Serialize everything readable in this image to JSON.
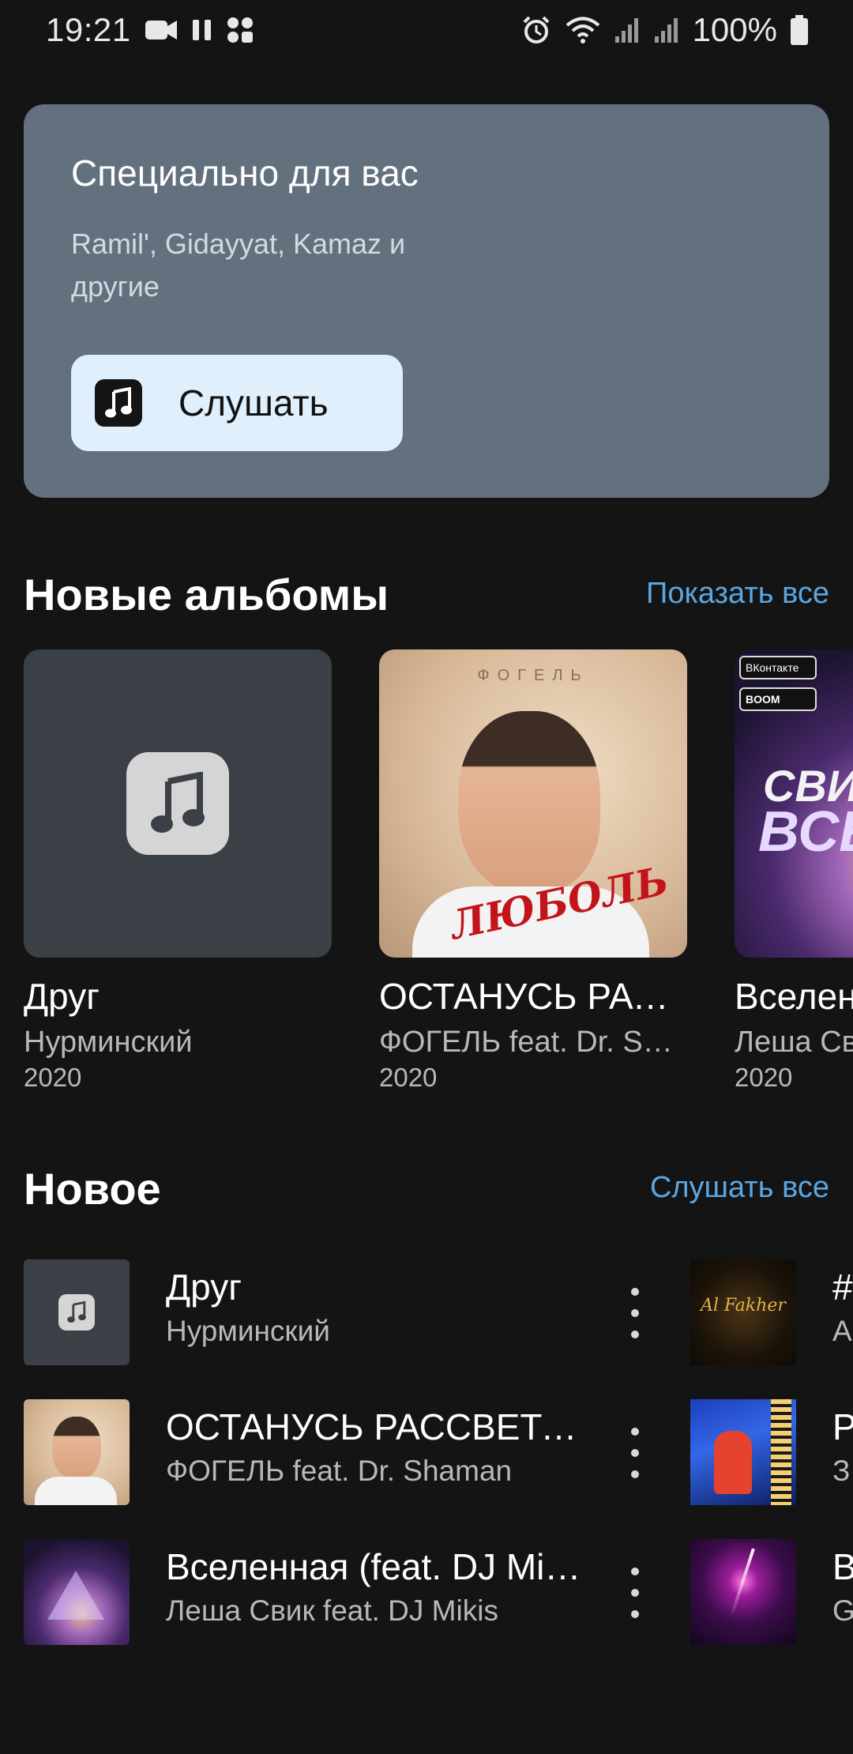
{
  "status_bar": {
    "time": "19:21",
    "battery": "100%",
    "left_icons": [
      "video-camera-icon",
      "pause-icon",
      "app-grid-lock-icon"
    ],
    "right_icons": [
      "alarm-icon",
      "wifi-icon",
      "signal-icon",
      "signal-icon",
      "battery-icon"
    ]
  },
  "featured": {
    "title": "Специально для вас",
    "subtitle": "Ramil', Gidayyat, Kamaz и другие",
    "button_label": "Слушать",
    "button_icon": "music-note-icon",
    "background": "#63707e",
    "button_background": "#dfeffc"
  },
  "albums_section": {
    "title": "Новые альбомы",
    "link": "Показать все",
    "items": [
      {
        "title": "Друг",
        "artist": "Нурминский",
        "year": "2020",
        "cover": "placeholder"
      },
      {
        "title": "ОСТАНУСЬ РАССВЕТОМ",
        "artist": "ФОГЕЛЬ feat. Dr. Shaman",
        "year": "2020",
        "cover": "fogel",
        "cover_text": {
          "brand": "ФОГЕЛЬ",
          "red": "ЛЮБОЛЬ"
        }
      },
      {
        "title": "Вселенная",
        "artist": "Леша Свик",
        "year": "2020",
        "cover": "space",
        "cover_text": {
          "vk": "ВКонтакте",
          "boom": "BOOM",
          "word1": "СВИК",
          "word2": "ВСЕЛ"
        }
      }
    ]
  },
  "new_section": {
    "title": "Новое",
    "link": "Слушать все",
    "tracks": [
      {
        "title": "Друг",
        "artist": "Нурминский",
        "cover": "placeholder"
      },
      {
        "title": "ОСТАНУСЬ РАССВЕТОМ",
        "artist": "ФОГЕЛЬ feat. Dr. Shaman",
        "cover": "fogel"
      },
      {
        "title": "Вселенная (feat. DJ Mikis)",
        "artist": "Леша Свик feat. DJ Mikis",
        "cover": "space"
      }
    ],
    "tracks_col2": [
      {
        "title": "#",
        "artist": "A",
        "cover": "alfakher",
        "cover_text": "Al Fakher"
      },
      {
        "title": "P",
        "artist": "З",
        "cover": "concert"
      },
      {
        "title": "B",
        "artist": "G",
        "cover": "galaxy"
      }
    ]
  },
  "colors": {
    "background": "#141414",
    "accent_link": "#5aa7e2",
    "secondary_text": "#b8b8b8"
  }
}
